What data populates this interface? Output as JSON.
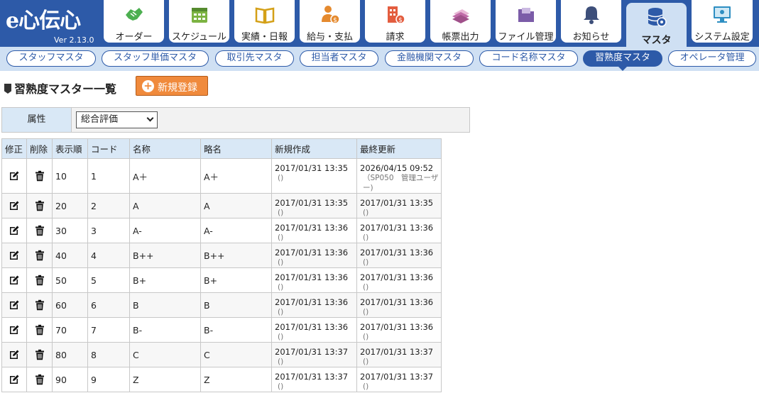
{
  "app": {
    "logo_text": "e心伝心",
    "version": "Ver 2.13.0"
  },
  "nav": [
    {
      "label": "オーダー",
      "icon": "handshake-icon",
      "color": "#4caf50"
    },
    {
      "label": "スケジュール",
      "icon": "calendar-icon",
      "color": "#7cb342"
    },
    {
      "label": "実績・日報",
      "icon": "book-icon",
      "color": "#d4a017"
    },
    {
      "label": "給与・支払",
      "icon": "person-coin-icon",
      "color": "#e58a2e"
    },
    {
      "label": "請求",
      "icon": "building-icon",
      "color": "#e35d3f"
    },
    {
      "label": "帳票出力",
      "icon": "documents-icon",
      "color": "#c06ba8"
    },
    {
      "label": "ファイル管理",
      "icon": "folder-icon",
      "color": "#7b5ca8"
    },
    {
      "label": "お知らせ",
      "icon": "bell-icon",
      "color": "#3d4f7a"
    },
    {
      "label": "マスタ",
      "icon": "database-gear-icon",
      "color": "#2d5aa8"
    },
    {
      "label": "システム設定",
      "icon": "monitor-gear-icon",
      "color": "#2d8ec2"
    }
  ],
  "subnav": [
    "スタッフマスタ",
    "スタッフ単価マスタ",
    "取引先マスタ",
    "担当者マスタ",
    "金融機関マスタ",
    "コード名称マスタ",
    "習熟度マスタ",
    "オペレータ管理"
  ],
  "page": {
    "title": "習熟度マスター一覧",
    "new_button": "新規登録"
  },
  "filter": {
    "label": "属性",
    "selected": "総合評価"
  },
  "table": {
    "headers": [
      "修正",
      "削除",
      "表示順",
      "コード",
      "名称",
      "略名",
      "新規作成",
      "最終更新"
    ],
    "rows": [
      {
        "order": "10",
        "code": "1",
        "name": "A＋",
        "short": "A＋",
        "created": "2017/01/31 13:35",
        "created_by": "()",
        "updated": "2026/04/15 09:52",
        "updated_by": "（SP050　管理ユーザー)"
      },
      {
        "order": "20",
        "code": "2",
        "name": "A",
        "short": "A",
        "created": "2017/01/31 13:35",
        "created_by": "()",
        "updated": "2017/01/31 13:35",
        "updated_by": "()"
      },
      {
        "order": "30",
        "code": "3",
        "name": "A-",
        "short": "A-",
        "created": "2017/01/31 13:36",
        "created_by": "()",
        "updated": "2017/01/31 13:36",
        "updated_by": "()"
      },
      {
        "order": "40",
        "code": "4",
        "name": "B++",
        "short": "B++",
        "created": "2017/01/31 13:36",
        "created_by": "()",
        "updated": "2017/01/31 13:36",
        "updated_by": "()"
      },
      {
        "order": "50",
        "code": "5",
        "name": "B+",
        "short": "B+",
        "created": "2017/01/31 13:36",
        "created_by": "()",
        "updated": "2017/01/31 13:36",
        "updated_by": "()"
      },
      {
        "order": "60",
        "code": "6",
        "name": "B",
        "short": "B",
        "created": "2017/01/31 13:36",
        "created_by": "()",
        "updated": "2017/01/31 13:36",
        "updated_by": "()"
      },
      {
        "order": "70",
        "code": "7",
        "name": "B-",
        "short": "B-",
        "created": "2017/01/31 13:36",
        "created_by": "()",
        "updated": "2017/01/31 13:36",
        "updated_by": "()"
      },
      {
        "order": "80",
        "code": "8",
        "name": "C",
        "short": "C",
        "created": "2017/01/31 13:37",
        "created_by": "()",
        "updated": "2017/01/31 13:37",
        "updated_by": "()"
      },
      {
        "order": "90",
        "code": "9",
        "name": "Z",
        "short": "Z",
        "created": "2017/01/31 13:37",
        "created_by": "()",
        "updated": "2017/01/31 13:37",
        "updated_by": "()"
      }
    ]
  },
  "colors": {
    "brand": "#2d5aa8",
    "accent": "#f08a3c",
    "subnav_bg": "#cfe0f3",
    "header_cell": "#d9e8f6"
  }
}
